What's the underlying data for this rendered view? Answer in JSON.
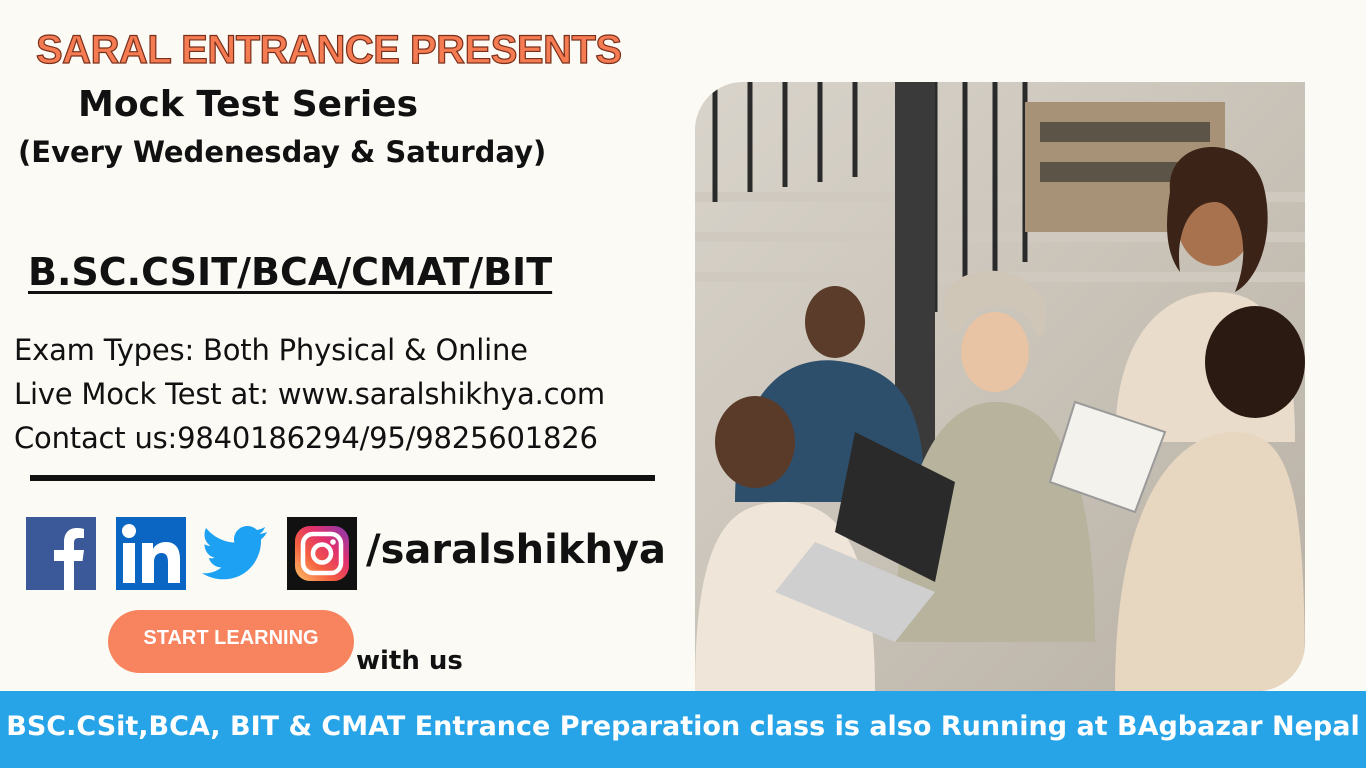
{
  "headline": "SARAL ENTRANCE PRESENTS",
  "series_title": "Mock Test Series",
  "schedule": "(Every Wedenesday & Saturday)",
  "programs": "B.SC.CSIT/BCA/CMAT/BIT",
  "info": {
    "exam_types": "Exam Types: Both Physical & Online",
    "live_test": "Live Mock Test at: www.saralshikhya.com",
    "contact": "Contact us:9840186294/95/9825601826"
  },
  "social": {
    "icons": [
      "facebook-icon",
      "linkedin-icon",
      "twitter-icon",
      "instagram-icon"
    ],
    "handle": "/saralshikhya"
  },
  "cta": {
    "button_label": "START LEARNING",
    "suffix": "with us"
  },
  "banner": {
    "text": "BSC.CSit,BCA, BIT & CMAT Entrance  Preparation class is also Running at BAgbazar Nepal"
  },
  "colors": {
    "accent": "#f47b52",
    "button": "#f7845e",
    "banner": "#27a4e8",
    "facebook": "#3b5998",
    "linkedin": "#0a66c2",
    "twitter": "#1da1f2"
  }
}
